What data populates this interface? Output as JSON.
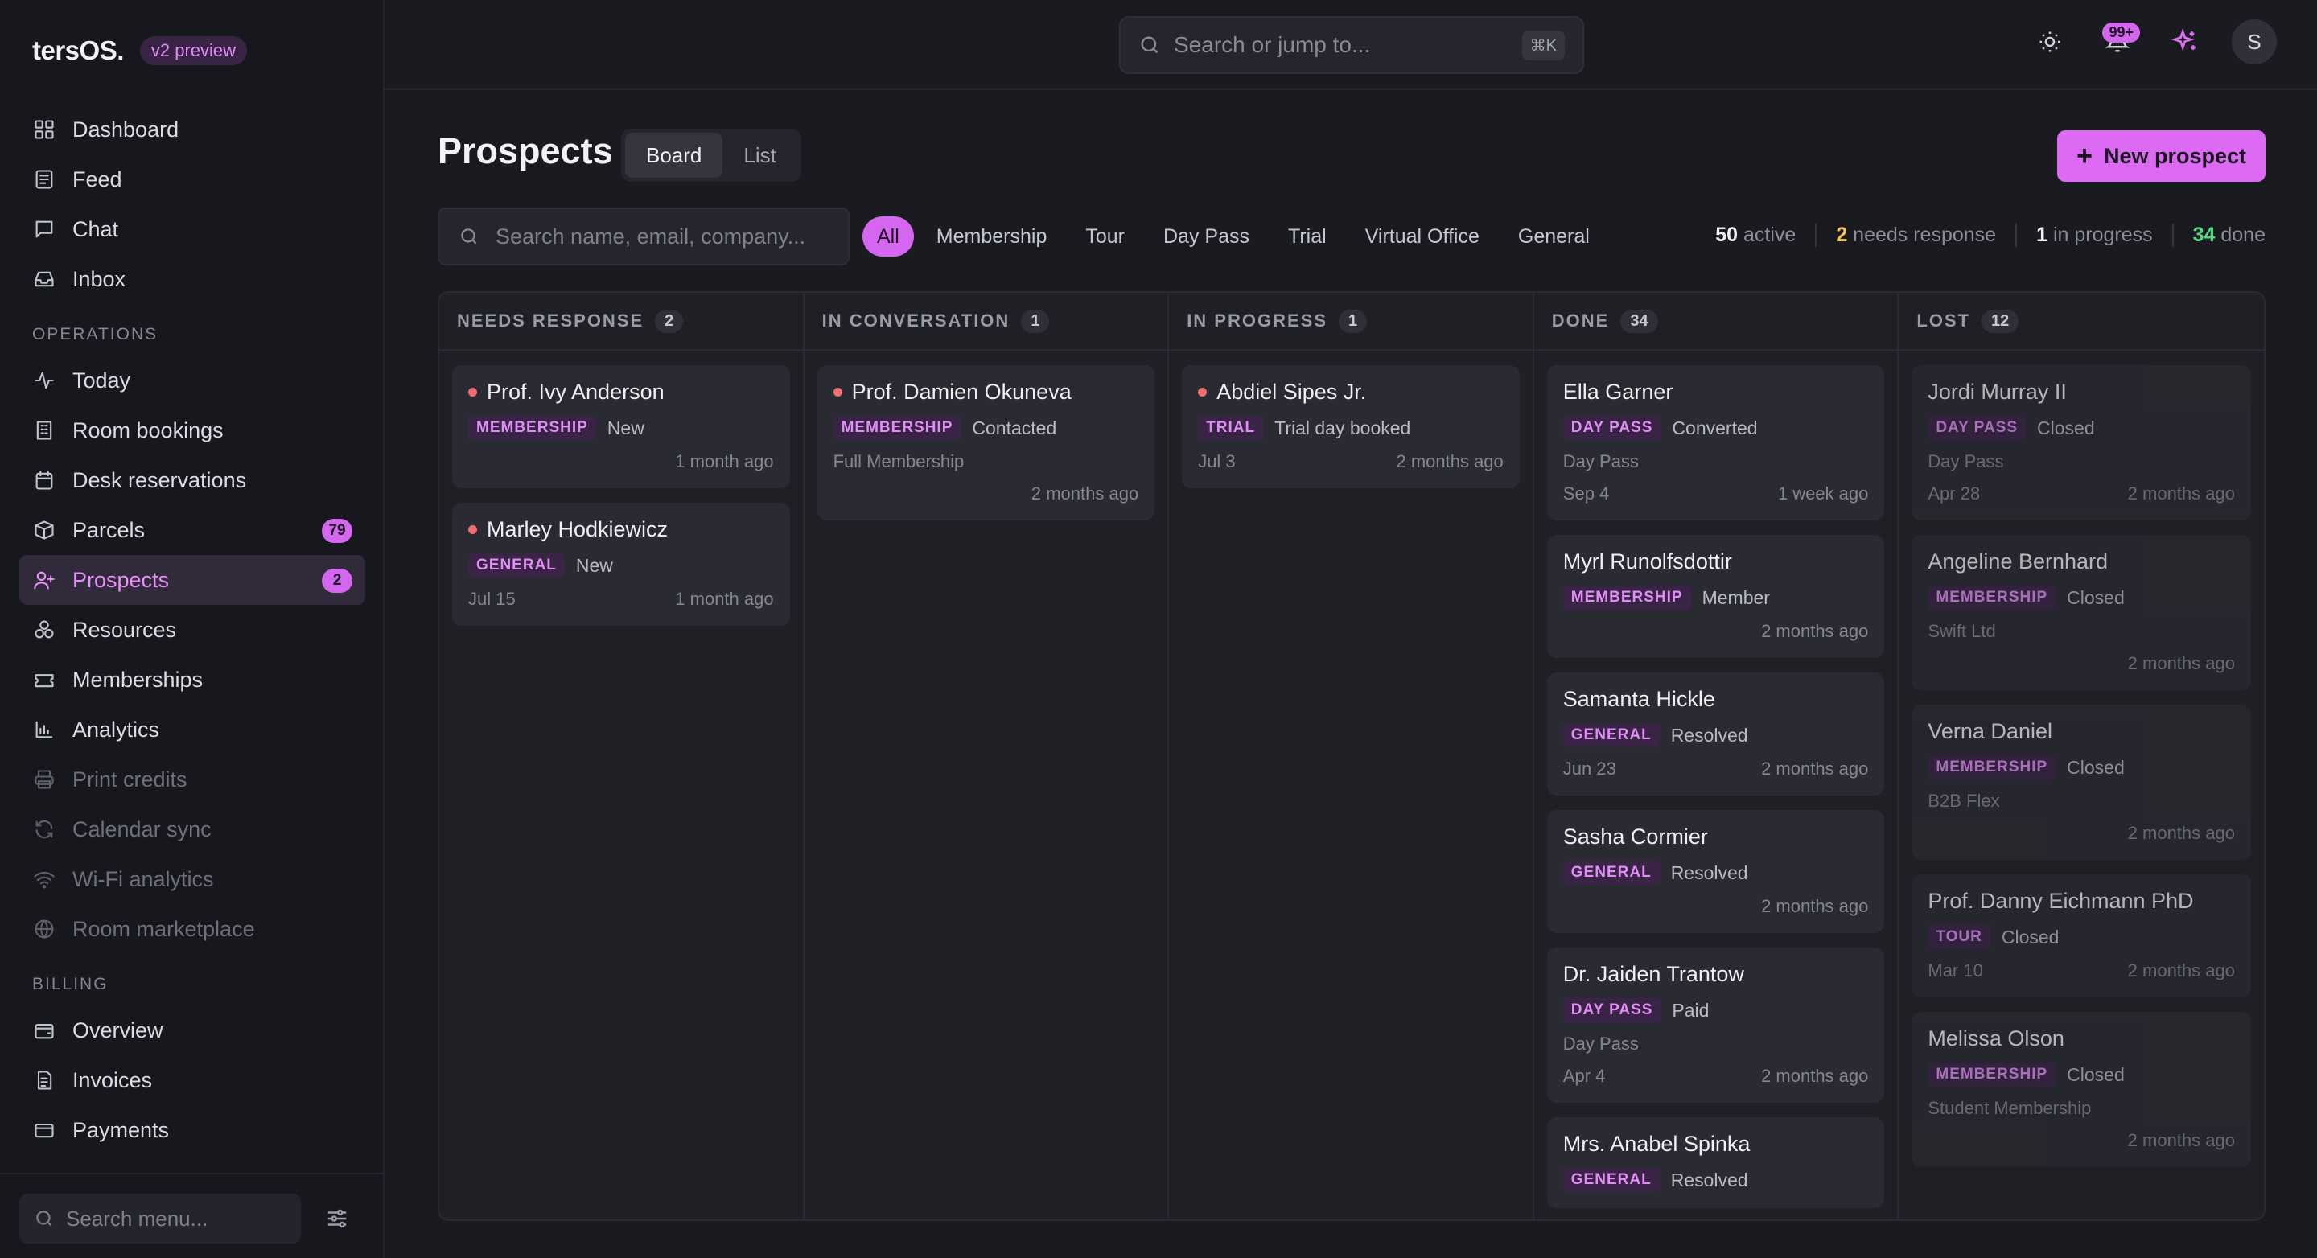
{
  "brand": {
    "name": "tersOS.",
    "badge": "v2 preview"
  },
  "nav": {
    "main": [
      {
        "label": "Dashboard",
        "icon": "dashboard-icon"
      },
      {
        "label": "Feed",
        "icon": "feed-icon"
      },
      {
        "label": "Chat",
        "icon": "chat-icon"
      },
      {
        "label": "Inbox",
        "icon": "inbox-icon"
      }
    ],
    "operations_label": "OPERATIONS",
    "operations": [
      {
        "label": "Today",
        "icon": "activity-icon"
      },
      {
        "label": "Room bookings",
        "icon": "building-icon"
      },
      {
        "label": "Desk reservations",
        "icon": "calendar-icon"
      },
      {
        "label": "Parcels",
        "icon": "package-icon",
        "badge": "79"
      },
      {
        "label": "Prospects",
        "icon": "user-plus-icon",
        "badge": "2"
      },
      {
        "label": "Resources",
        "icon": "resources-icon"
      },
      {
        "label": "Memberships",
        "icon": "ticket-icon"
      },
      {
        "label": "Analytics",
        "icon": "bar-chart-icon"
      },
      {
        "label": "Print credits",
        "icon": "printer-icon"
      },
      {
        "label": "Calendar sync",
        "icon": "sync-icon"
      },
      {
        "label": "Wi-Fi analytics",
        "icon": "wifi-icon"
      },
      {
        "label": "Room marketplace",
        "icon": "globe-icon"
      }
    ],
    "billing_label": "BILLING",
    "billing": [
      {
        "label": "Overview",
        "icon": "wallet-icon"
      },
      {
        "label": "Invoices",
        "icon": "invoice-icon"
      },
      {
        "label": "Payments",
        "icon": "card-icon"
      }
    ],
    "search_placeholder": "Search menu..."
  },
  "topbar": {
    "search_placeholder": "Search or jump to...",
    "shortcut": "⌘K",
    "notifications": "99+",
    "avatar": "S"
  },
  "header": {
    "title": "Prospects",
    "views": [
      "Board",
      "List"
    ],
    "new_button": "New prospect"
  },
  "filters": {
    "search_placeholder": "Search name, email, company...",
    "chips": [
      "All",
      "Membership",
      "Tour",
      "Day Pass",
      "Trial",
      "Virtual Office",
      "General"
    ]
  },
  "stats": [
    {
      "value": "50",
      "label": "active",
      "color": "#f0f0f4"
    },
    {
      "value": "2",
      "label": "needs response",
      "color": "#f5c451"
    },
    {
      "value": "1",
      "label": "in progress",
      "color": "#f0f0f4"
    },
    {
      "value": "34",
      "label": "done",
      "color": "#4fd97a"
    }
  ],
  "columns": [
    {
      "title": "NEEDS RESPONSE",
      "count": "2",
      "cards": [
        {
          "name": "Prof. Ivy Anderson",
          "dot": true,
          "tag": "MEMBERSHIP",
          "status": "New",
          "sub": "",
          "date": "",
          "ago": "1 month ago"
        },
        {
          "name": "Marley Hodkiewicz",
          "dot": true,
          "tag": "GENERAL",
          "status": "New",
          "sub": "",
          "date": "Jul 15",
          "ago": "1 month ago"
        }
      ]
    },
    {
      "title": "IN CONVERSATION",
      "count": "1",
      "cards": [
        {
          "name": "Prof. Damien Okuneva",
          "dot": true,
          "tag": "MEMBERSHIP",
          "status": "Contacted",
          "sub": "Full Membership",
          "date": "",
          "ago": "2 months ago"
        }
      ]
    },
    {
      "title": "IN PROGRESS",
      "count": "1",
      "cards": [
        {
          "name": "Abdiel Sipes Jr.",
          "dot": true,
          "tag": "TRIAL",
          "status": "Trial day booked",
          "sub": "",
          "date": "Jul 3",
          "ago": "2 months ago"
        }
      ]
    },
    {
      "title": "DONE",
      "count": "34",
      "cards": [
        {
          "name": "Ella Garner",
          "dot": false,
          "tag": "DAY PASS",
          "status": "Converted",
          "sub": "Day Pass",
          "date": "Sep 4",
          "ago": "1 week ago"
        },
        {
          "name": "Myrl Runolfsdottir",
          "dot": false,
          "tag": "MEMBERSHIP",
          "status": "Member",
          "sub": "",
          "date": "",
          "ago": "2 months ago"
        },
        {
          "name": "Samanta Hickle",
          "dot": false,
          "tag": "GENERAL",
          "status": "Resolved",
          "sub": "",
          "date": "Jun 23",
          "ago": "2 months ago"
        },
        {
          "name": "Sasha Cormier",
          "dot": false,
          "tag": "GENERAL",
          "status": "Resolved",
          "sub": "",
          "date": "",
          "ago": "2 months ago"
        },
        {
          "name": "Dr. Jaiden Trantow",
          "dot": false,
          "tag": "DAY PASS",
          "status": "Paid",
          "sub": "Day Pass",
          "date": "Apr 4",
          "ago": "2 months ago"
        },
        {
          "name": "Mrs. Anabel Spinka",
          "dot": false,
          "tag": "GENERAL",
          "status": "Resolved",
          "sub": "",
          "date": "",
          "ago": ""
        }
      ]
    },
    {
      "title": "LOST",
      "count": "12",
      "cards": [
        {
          "name": "Jordi Murray II",
          "dot": false,
          "tag": "DAY PASS",
          "status": "Closed",
          "sub": "Day Pass",
          "date": "Apr 28",
          "ago": "2 months ago"
        },
        {
          "name": "Angeline Bernhard",
          "dot": false,
          "tag": "MEMBERSHIP",
          "status": "Closed",
          "sub": "Swift Ltd",
          "date": "",
          "ago": "2 months ago"
        },
        {
          "name": "Verna Daniel",
          "dot": false,
          "tag": "MEMBERSHIP",
          "status": "Closed",
          "sub": "B2B Flex",
          "date": "",
          "ago": "2 months ago"
        },
        {
          "name": "Prof. Danny Eichmann PhD",
          "dot": false,
          "tag": "TOUR",
          "status": "Closed",
          "sub": "",
          "date": "Mar 10",
          "ago": "2 months ago"
        },
        {
          "name": "Melissa Olson",
          "dot": false,
          "tag": "MEMBERSHIP",
          "status": "Closed",
          "sub": "Student Membership",
          "date": "",
          "ago": "2 months ago"
        }
      ]
    }
  ]
}
